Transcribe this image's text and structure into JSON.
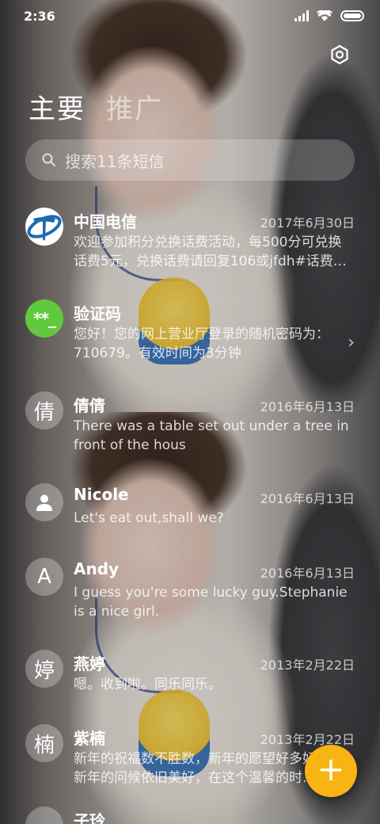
{
  "status_bar": {
    "time": "2:36"
  },
  "tabs": [
    {
      "label": "主要"
    },
    {
      "label": "推广"
    }
  ],
  "search": {
    "placeholder": "搜索11条短信"
  },
  "messages": [
    {
      "name": "中国电信",
      "date": "2017年6月30日",
      "preview": "欢迎参加积分兑换话费活动，每500分可兑换话费5元，兑换话费请回复106或jfdh#话费…",
      "avatar": "china-telecom-logo"
    },
    {
      "name": "验证码",
      "date": "",
      "preview": "您好！您的网上营业厅登录的随机密码为：710679。有效时间为3分钟",
      "avatar_text": "**_"
    },
    {
      "name": "倩倩",
      "date": "2016年6月13日",
      "preview": "There was a table set out under a tree in front of the hous",
      "avatar_text": "倩"
    },
    {
      "name": "Nicole",
      "date": "2016年6月13日",
      "preview": "Let's eat out,shall we?",
      "avatar": "person-icon"
    },
    {
      "name": "Andy",
      "date": "2016年6月13日",
      "preview": "I guess you're some lucky guy.Stephanie is a nice girl.",
      "avatar_text": "A"
    },
    {
      "name": "燕婷",
      "date": "2013年2月22日",
      "preview": "嗯。收到啦。同乐同乐。",
      "avatar_text": "婷"
    },
    {
      "name": "紫楠",
      "date": "2013年2月22日",
      "preview": "新年的祝福数不胜数，新年的愿望好多好多，新年的问候依旧美好，在这个温馨的时…",
      "avatar_text": "楠"
    },
    {
      "name": "子玲",
      "date": "",
      "preview": "",
      "avatar_text": ""
    }
  ],
  "colors": {
    "fab": "#f8b412",
    "verify_avatar": "#61c93e",
    "telecom_blue": "#1e6ab4"
  }
}
